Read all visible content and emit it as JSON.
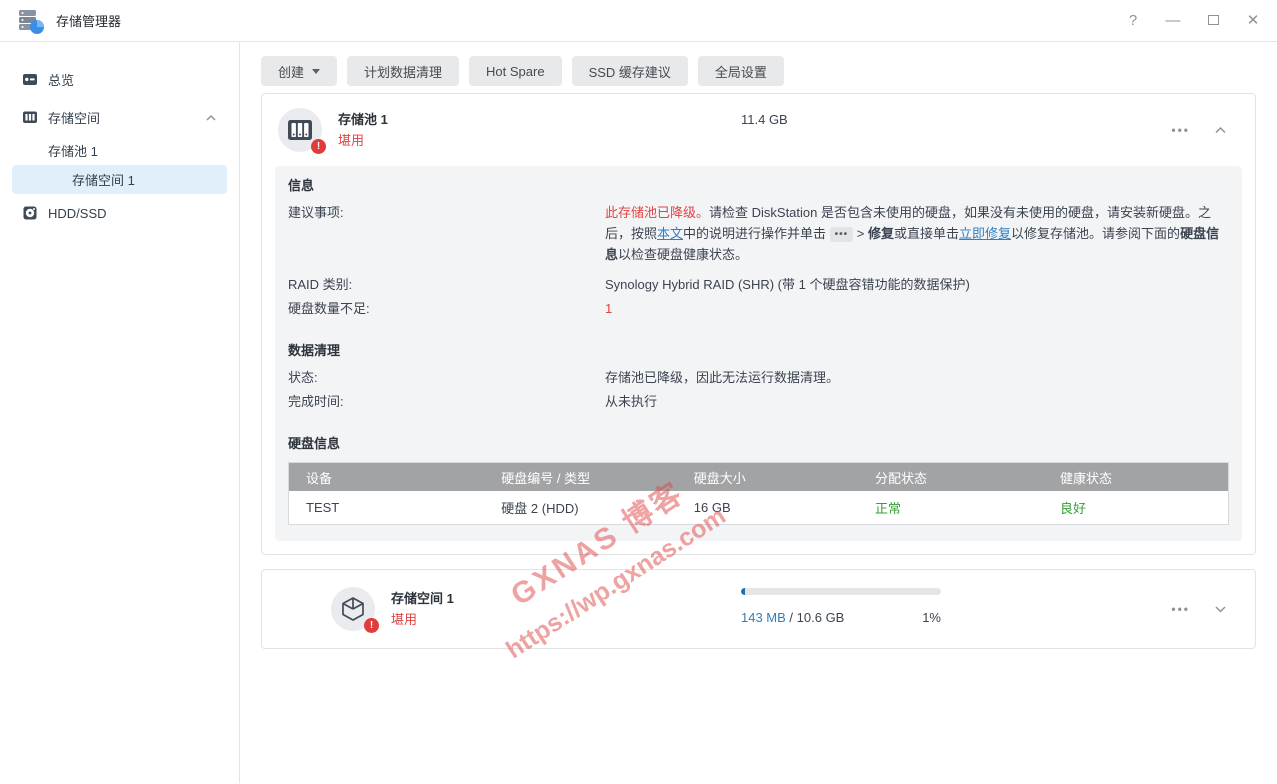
{
  "colors": {
    "accent_red": "#e04343",
    "link_blue": "#2f7fc1",
    "ok_green": "#35a035",
    "progress_blue": "#1e6fb2",
    "selected_item_bg": "#e1effa",
    "table_header_bg": "#a2a3a5"
  },
  "window": {
    "title": "存储管理器",
    "help_icon": "?",
    "minimize_icon": "—",
    "close_icon": "✕"
  },
  "sidebar": {
    "items": [
      {
        "label": "总览"
      },
      {
        "label": "存储空间"
      },
      {
        "label": "存储池 1"
      },
      {
        "label": "存储空间 1"
      },
      {
        "label": "HDD/SSD"
      }
    ]
  },
  "toolbar": {
    "buttons": [
      {
        "label": "创建"
      },
      {
        "label": "计划数据清理"
      },
      {
        "label": "Hot Spare"
      },
      {
        "label": "SSD 缓存建议"
      },
      {
        "label": "全局设置"
      }
    ]
  },
  "pool_card": {
    "title": "存储池 1",
    "status": "堪用",
    "capacity": "11.4 GB",
    "menu_dots": "•••",
    "info": {
      "heading": "信息",
      "advisory_label": "建议事项:",
      "advisory_segments": [
        {
          "style": "red",
          "text": "此存储池已降级。"
        },
        {
          "style": "plain",
          "text": "请检查 DiskStation 是否包含未使用的硬盘，如果没有未使用的硬盘，请安装新硬盘。之后，按照"
        },
        {
          "style": "link",
          "text": "本文"
        },
        {
          "style": "plain",
          "text": "中的说明进行操作并单击 "
        },
        {
          "style": "chip",
          "text": "•••"
        },
        {
          "style": "plain",
          "text": " > "
        },
        {
          "style": "bold",
          "text": "修复"
        },
        {
          "style": "plain",
          "text": "或直接单击"
        },
        {
          "style": "link",
          "text": "立即修复"
        },
        {
          "style": "plain",
          "text": "以修复存储池。请参阅下面的"
        },
        {
          "style": "bold",
          "text": "硬盘信息"
        },
        {
          "style": "plain",
          "text": "以检查硬盘健康状态。"
        }
      ],
      "raid_label": "RAID 类别:",
      "raid_value": "Synology Hybrid RAID (SHR) (带 1 个硬盘容错功能的数据保护)",
      "missing_label": "硬盘数量不足:",
      "missing_value": "1"
    },
    "scrub": {
      "heading": "数据清理",
      "status_label": "状态:",
      "status_value": "存储池已降级，因此无法运行数据清理。",
      "finish_label": "完成时间:",
      "finish_value": "从未执行"
    },
    "disks": {
      "heading": "硬盘信息",
      "headers": [
        "设备",
        "硬盘编号 / 类型",
        "硬盘大小",
        "分配状态",
        "健康状态"
      ],
      "rows": [
        {
          "device": "TEST",
          "slot": "硬盘 2 (HDD)",
          "size": "16 GB",
          "alloc": "正常",
          "health": "良好"
        }
      ]
    }
  },
  "volume_card": {
    "title": "存储空间 1",
    "status": "堪用",
    "used": "143 MB",
    "separator": " / ",
    "total": "10.6 GB",
    "percent_label": "1%",
    "fill_pct": 2,
    "menu_dots": "•••"
  },
  "watermark": {
    "line1": "GXNAS 博客",
    "line2": "https://wp.gxnas.com"
  }
}
